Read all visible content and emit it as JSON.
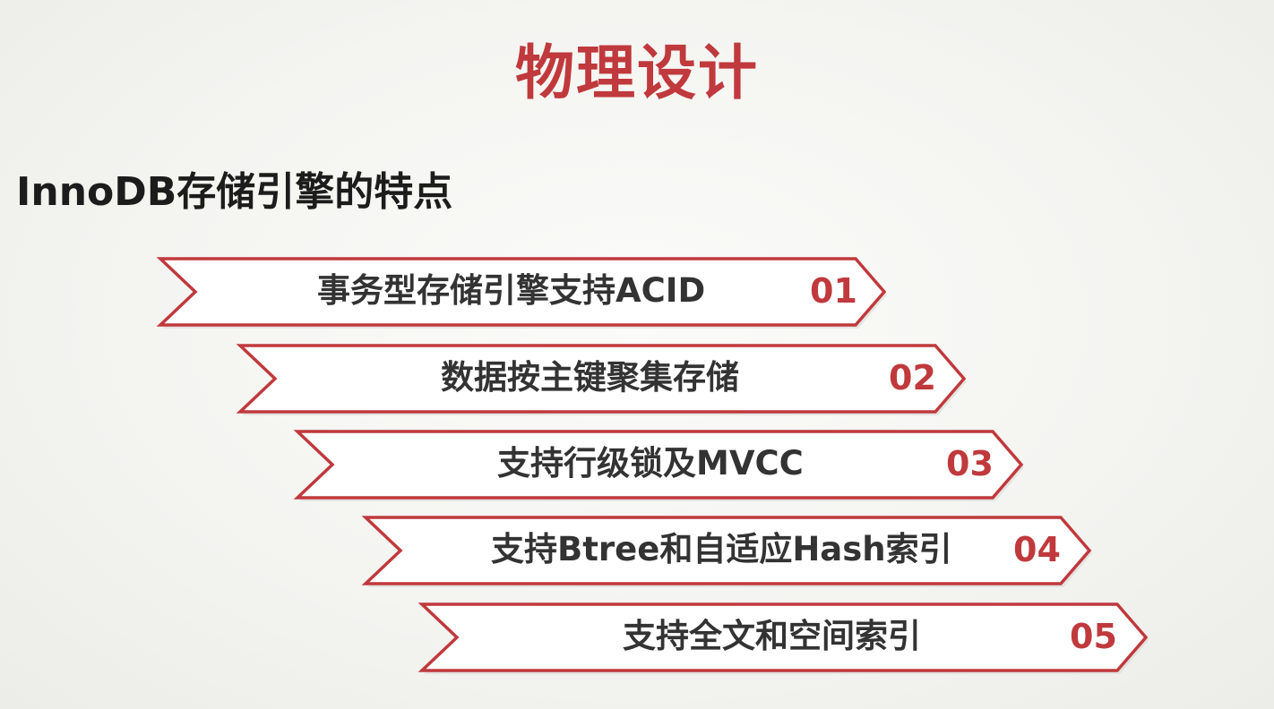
{
  "title": "物理设计",
  "subtitle": "InnoDB存储引擎的特点",
  "accent_color": "#c0393c",
  "items": [
    {
      "label": "事务型存储引擎支持ACID",
      "number": "01"
    },
    {
      "label": "数据按主键聚集存储",
      "number": "02"
    },
    {
      "label": "支持行级锁及MVCC",
      "number": "03"
    },
    {
      "label": "支持Btree和自适应Hash索引",
      "number": "04"
    },
    {
      "label": "支持全文和空间索引",
      "number": "05"
    }
  ]
}
